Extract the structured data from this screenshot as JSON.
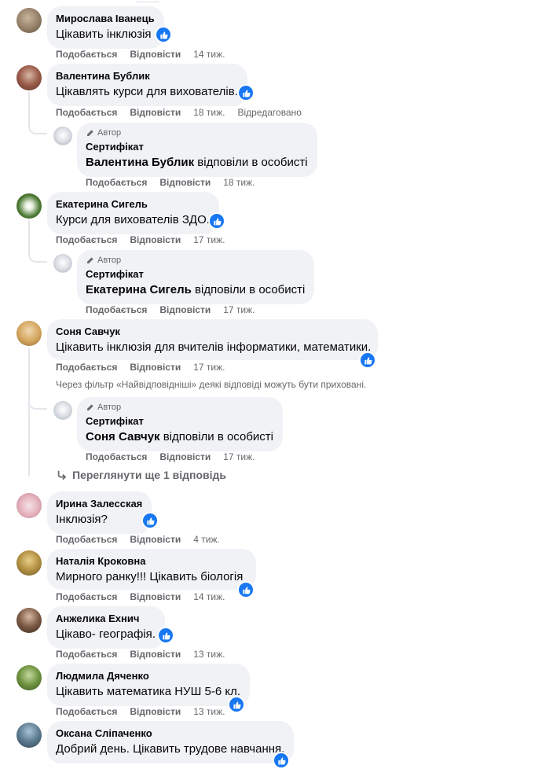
{
  "labels": {
    "like": "Подобається",
    "reply": "Відповісти",
    "author": "Автор",
    "edited": "Відредаговано"
  },
  "filter_note": "Через фільтр «Найвідповідніші» деякі відповіді можуть бути приховані.",
  "more_replies": "Переглянути ще 1 відповідь",
  "reply_suffix": " відповіли в особисті",
  "comments": [
    {
      "name": "Мирослава Іванець",
      "text": "Цікавить інклюзія",
      "time": "14 тиж."
    },
    {
      "name": "Валентина Бублик",
      "text": "Цікавлять курси для вихователів.",
      "time": "18 тиж."
    },
    {
      "name": "Екатерина Сигель",
      "text": "Курси для вихователів ЗДО.",
      "time": "17 тиж."
    },
    {
      "name": "Соня Савчук",
      "text": "Цікавить інклюзія для вчителів інформатики, математики.",
      "time": "17 тиж."
    },
    {
      "name": "Ирина Залесская",
      "text": "Інклюзія?",
      "time": "4 тиж."
    },
    {
      "name": "Наталія Кроковна",
      "text": "Мирного ранку!!! Цікавить біологія",
      "time": "14 тиж."
    },
    {
      "name": "Анжелика Ехнич",
      "text": "Цікаво- географія.",
      "time": "13 тиж."
    },
    {
      "name": "Людмила Дяченко",
      "text": "Цікавить математика НУШ 5-6 кл.",
      "time": "13 тиж."
    },
    {
      "name": "Оксана Сліпаченко",
      "text": "Добрий день. Цікавить трудове навчання."
    }
  ],
  "replies": [
    {
      "author_name": "Сертифікат",
      "mention": "Валентина Бублик",
      "time": "18 тиж."
    },
    {
      "author_name": "Сертифікат",
      "mention": "Екатерина Сигель",
      "time": "17 тиж."
    },
    {
      "author_name": "Сертифікат",
      "mention": "Соня Савчук",
      "time": "17 тиж."
    }
  ],
  "colors": {
    "bubble": "#f0f2f5",
    "secondary_text": "#65676b",
    "like_blue": "#1877f2",
    "thread_line": "#e4e6eb"
  }
}
